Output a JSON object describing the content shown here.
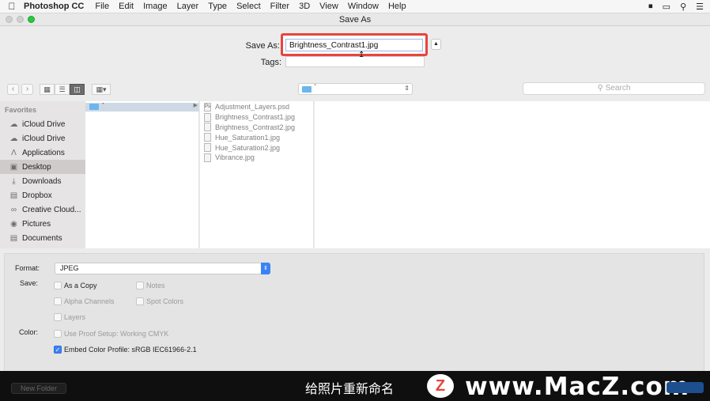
{
  "menubar": {
    "app": "Photoshop CC",
    "items": [
      "File",
      "Edit",
      "Image",
      "Layer",
      "Type",
      "Select",
      "Filter",
      "3D",
      "View",
      "Window",
      "Help"
    ]
  },
  "window": {
    "title": "Save As"
  },
  "save_as": {
    "label": "Save As:",
    "filename": "Brightness_Contrast1.jpg",
    "tags_label": "Tags:",
    "tags_value": ""
  },
  "toolbar": {
    "location": "`",
    "search_placeholder": "Search"
  },
  "sidebar": {
    "heading": "Favorites",
    "items": [
      {
        "label": "iCloud Drive",
        "icon": "cloud-icon"
      },
      {
        "label": "iCloud Drive",
        "icon": "cloud-icon"
      },
      {
        "label": "Applications",
        "icon": "applications-icon"
      },
      {
        "label": "Desktop",
        "icon": "desktop-icon",
        "selected": true
      },
      {
        "label": "Downloads",
        "icon": "download-icon"
      },
      {
        "label": "Dropbox",
        "icon": "folder-icon"
      },
      {
        "label": "Creative Cloud...",
        "icon": "creative-cloud-icon"
      },
      {
        "label": "Pictures",
        "icon": "camera-icon"
      },
      {
        "label": "Documents",
        "icon": "documents-icon"
      }
    ]
  },
  "column1": {
    "folder": "`"
  },
  "files": [
    {
      "name": "Adjustment_Layers.psd",
      "icon_text": "Ps"
    },
    {
      "name": "Brightness_Contrast1.jpg",
      "icon_text": ""
    },
    {
      "name": "Brightness_Contrast2.jpg",
      "icon_text": ""
    },
    {
      "name": "Hue_Saturation1.jpg",
      "icon_text": ""
    },
    {
      "name": "Hue_Saturation2.jpg",
      "icon_text": ""
    },
    {
      "name": "Vibrance.jpg",
      "icon_text": ""
    }
  ],
  "options": {
    "format_label": "Format:",
    "format_value": "JPEG",
    "save_label": "Save:",
    "as_a_copy": "As a Copy",
    "notes": "Notes",
    "alpha_channels": "Alpha Channels",
    "spot_colors": "Spot Colors",
    "layers": "Layers",
    "color_label": "Color:",
    "use_proof_setup": "Use Proof Setup:  Working CMYK",
    "embed_color_profile": "Embed Color Profile:  sRGB IEC61966-2.1"
  },
  "footer": {
    "new_folder": "New Folder",
    "subtitle": "给照片重新命名",
    "logo_letter": "Z",
    "watermark": "www.MacZ.com"
  },
  "colors": {
    "highlight_red": "#e8453c",
    "accent_blue": "#3b82f6",
    "folder_blue": "#6ab6ee"
  }
}
